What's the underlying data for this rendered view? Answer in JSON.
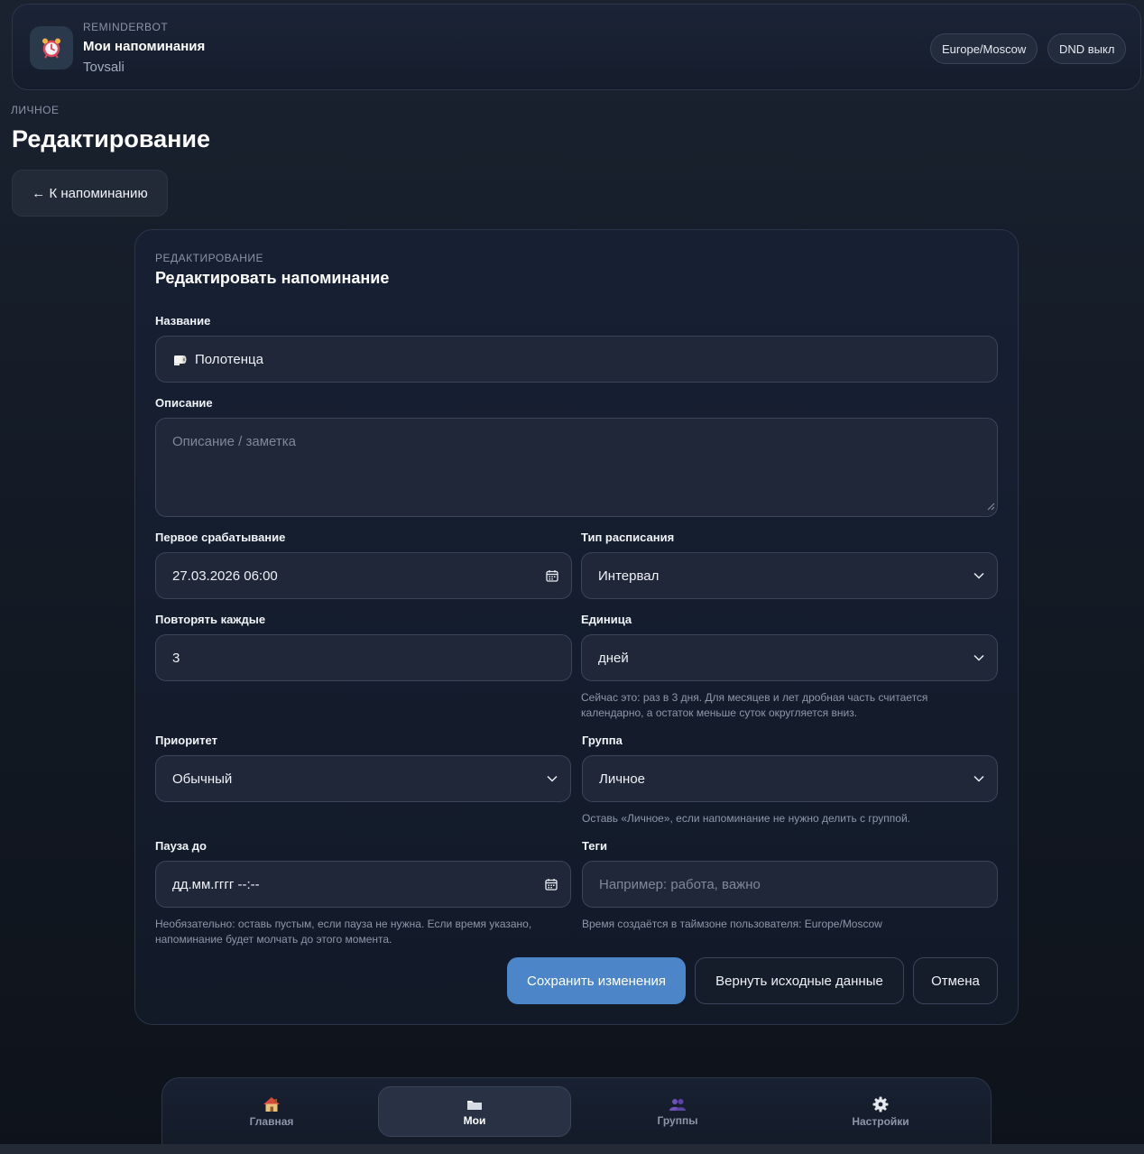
{
  "header": {
    "brand": "REMINDERBOT",
    "title": "Мои напоминания",
    "user": "Tovsali",
    "app_icon": "alarm-clock-icon",
    "timezone_chip": "Europe/Moscow",
    "dnd_chip": "DND выкл"
  },
  "page": {
    "section_label": "ЛИЧНОЕ",
    "title": "Редактирование",
    "back_button": "← К напоминанию"
  },
  "form": {
    "eyebrow": "РЕДАКТИРОВАНИЕ",
    "title": "Редактировать напоминание",
    "name": {
      "label": "Название",
      "value": "Полотенца",
      "icon": "toilet-paper-icon"
    },
    "description": {
      "label": "Описание",
      "placeholder": "Описание / заметка"
    },
    "first_trigger": {
      "label": "Первое срабатывание",
      "value": "27.03.2026 06:00"
    },
    "schedule_type": {
      "label": "Тип расписания",
      "value": "Интервал"
    },
    "repeat_every": {
      "label": "Повторять каждые",
      "value": "3"
    },
    "unit": {
      "label": "Единица",
      "value": "дней",
      "hint": "Сейчас это: раз в 3 дня. Для месяцев и лет дробная часть считается календарно, а остаток меньше суток округляется вниз."
    },
    "priority": {
      "label": "Приоритет",
      "value": "Обычный"
    },
    "group": {
      "label": "Группа",
      "value": "Личное",
      "hint": "Оставь «Личное», если напоминание не нужно делить с группой."
    },
    "pause_until": {
      "label": "Пауза до",
      "placeholder": "дд.мм.гггг --:--",
      "hint": "Необязательно: оставь пустым, если пауза не нужна. Если время указано, напоминание будет молчать до этого момента."
    },
    "tags": {
      "label": "Теги",
      "placeholder": "Например: работа, важно",
      "hint": "Время создаётся в таймзоне пользователя: Europe/Moscow"
    },
    "buttons": {
      "save": "Сохранить изменения",
      "reset": "Вернуть исходные данные",
      "cancel": "Отмена"
    }
  },
  "tabbar": {
    "items": [
      {
        "label": "Главная",
        "icon": "house-icon",
        "active": false
      },
      {
        "label": "Мои",
        "icon": "folder-icon",
        "active": true
      },
      {
        "label": "Группы",
        "icon": "people-icon",
        "active": false
      },
      {
        "label": "Настройки",
        "icon": "gear-icon",
        "active": false
      }
    ]
  },
  "colors": {
    "background": "#141b26",
    "card": "#172033",
    "field": "#1f2738",
    "field_border": "#3a4559",
    "primary_button": "#4c86c9",
    "muted_text": "#8d97a8"
  }
}
